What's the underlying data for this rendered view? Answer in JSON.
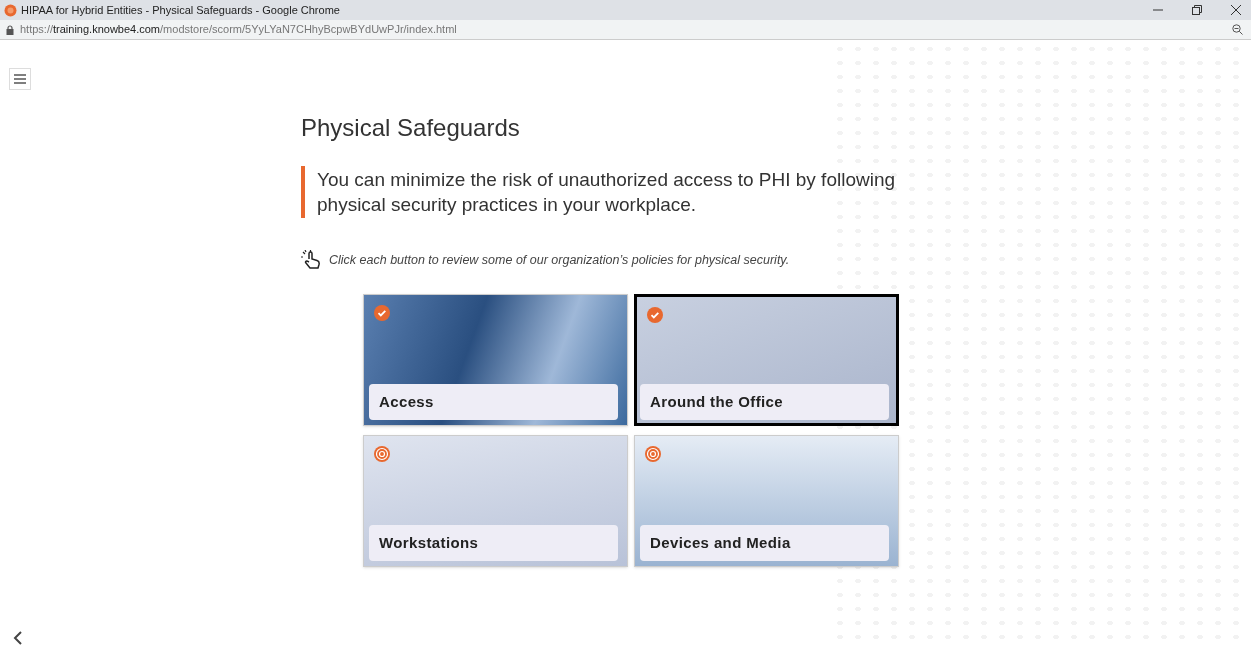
{
  "window": {
    "title": "HIPAA for Hybrid Entities - Physical Safeguards - Google Chrome"
  },
  "address_bar": {
    "scheme": "https://",
    "host": "training.knowbe4.com",
    "path": "/modstore/scorm/5YyLYaN7CHhyBcpwBYdUwPJr/index.html"
  },
  "page": {
    "heading": "Physical Safeguards",
    "callout": "You can minimize the risk of unauthorized access to PHI by following physical security practices in your workplace.",
    "instruction": "Click each button to review some of our organization’s policies for physical security."
  },
  "cards": [
    {
      "label": "Access",
      "completed": true,
      "selected": false
    },
    {
      "label": "Around the Office",
      "completed": true,
      "selected": true
    },
    {
      "label": "Workstations",
      "completed": false,
      "selected": false
    },
    {
      "label": "Devices and Media",
      "completed": false,
      "selected": false
    }
  ]
}
